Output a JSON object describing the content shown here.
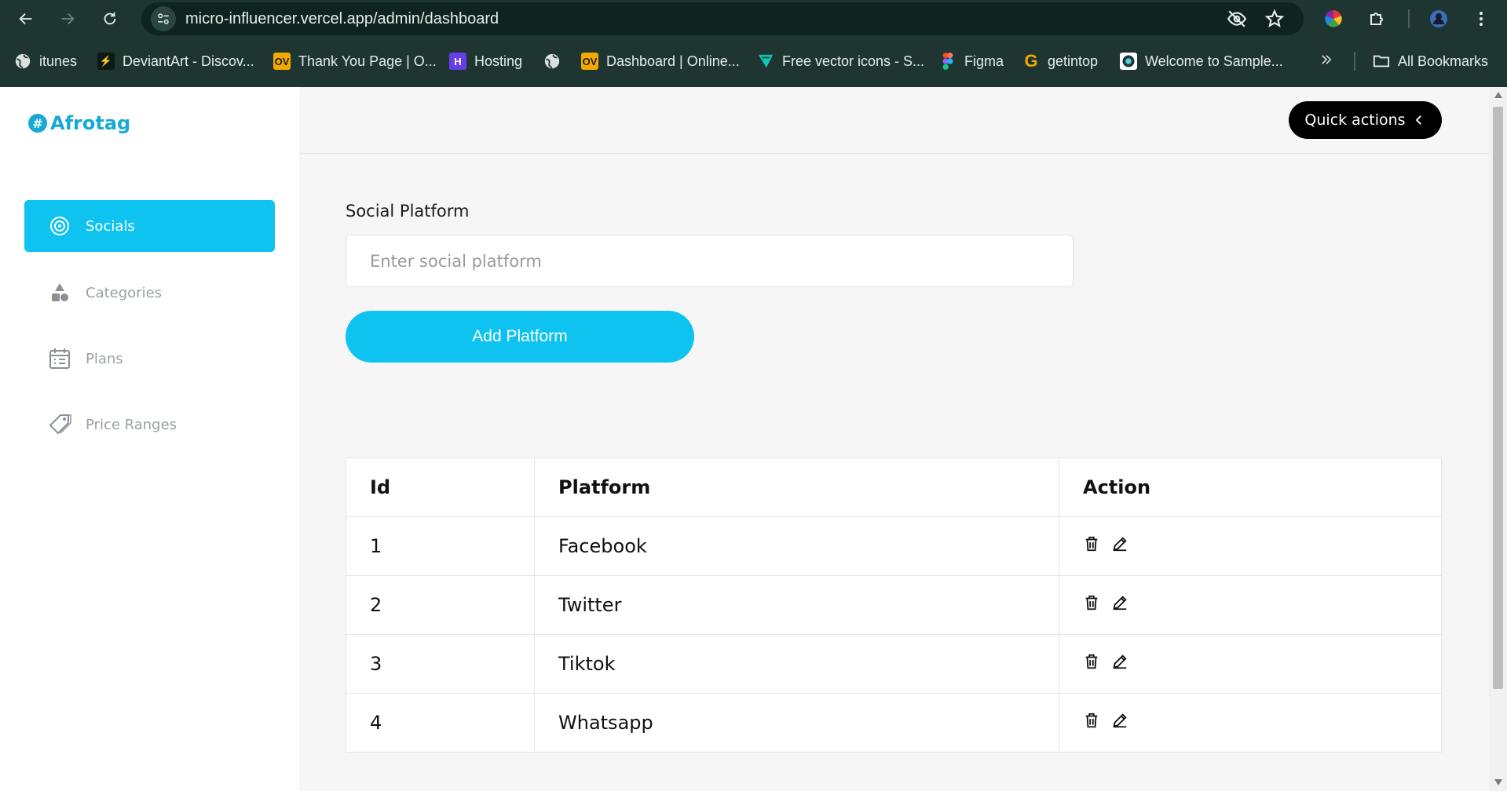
{
  "browser": {
    "url": "micro-influencer.vercel.app/admin/dashboard",
    "bookmarks": [
      {
        "label": "itunes",
        "icon": "globe-icon"
      },
      {
        "label": "DeviantArt - Discov...",
        "icon": "deviantart-icon"
      },
      {
        "label": "Thank You Page | O...",
        "icon": "ov-icon"
      },
      {
        "label": "Hosting",
        "icon": "hostinger-icon"
      },
      {
        "label": "",
        "icon": "globe-icon"
      },
      {
        "label": "Dashboard | Online...",
        "icon": "ov-icon"
      },
      {
        "label": "Free vector icons - S...",
        "icon": "flaticon-icon"
      },
      {
        "label": "Figma",
        "icon": "figma-icon"
      },
      {
        "label": "getintop",
        "icon": "getintop-icon"
      },
      {
        "label": "Welcome to Sample...",
        "icon": "sample-icon"
      }
    ],
    "all_bookmarks": "All Bookmarks",
    "ov_text": "OV",
    "g_text": "G"
  },
  "app": {
    "logo_text": "Afrotag",
    "logo_mark": "#",
    "accent": "#0ec3ef",
    "nav": [
      {
        "label": "Socials",
        "icon": "target-icon",
        "active": true
      },
      {
        "label": "Categories",
        "icon": "shapes-icon",
        "active": false
      },
      {
        "label": "Plans",
        "icon": "calendar-icon",
        "active": false
      },
      {
        "label": "Price Ranges",
        "icon": "tag-icon",
        "active": false
      }
    ],
    "quick_actions": "Quick actions"
  },
  "form": {
    "label": "Social Platform",
    "placeholder": "Enter social platform",
    "value": "",
    "submit": "Add Platform"
  },
  "table": {
    "headers": [
      "Id",
      "Platform",
      "Action"
    ],
    "rows": [
      {
        "id": "1",
        "platform": "Facebook"
      },
      {
        "id": "2",
        "platform": "Twitter"
      },
      {
        "id": "3",
        "platform": "Tiktok"
      },
      {
        "id": "4",
        "platform": "Whatsapp"
      }
    ],
    "actions": [
      "trash-icon",
      "pencil-icon"
    ]
  }
}
